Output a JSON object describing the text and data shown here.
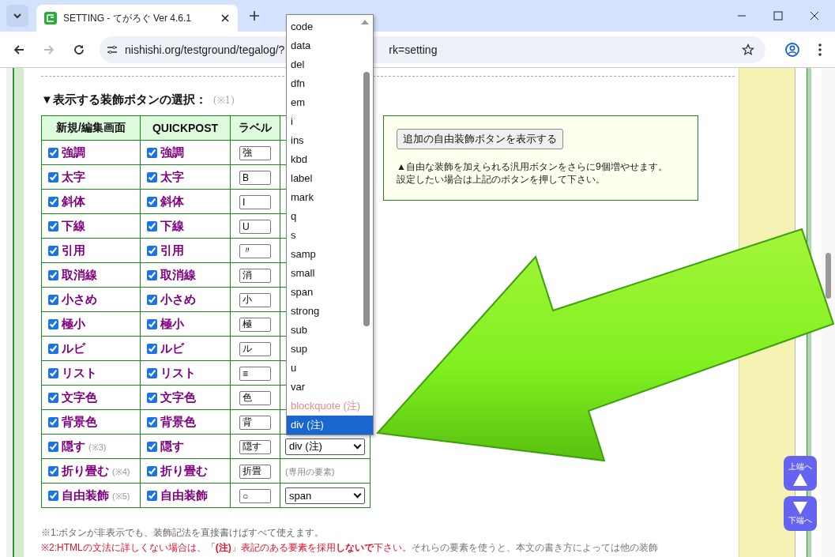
{
  "browser": {
    "tab_title": "SETTING - てがろぐ Ver 4.6.1",
    "url_parts": [
      "nishishi.org/testground/tegalog/?",
      "rk=setting"
    ],
    "forward_disabled": true
  },
  "heading": {
    "title": "▼表示する装飾ボタンの選択：",
    "note": "(※1)"
  },
  "table": {
    "columns": [
      "新規/編集画面",
      "QUICKPOST",
      "ラベル"
    ],
    "rows": [
      {
        "editor": {
          "checked": true,
          "label": "強調"
        },
        "quickpost": {
          "checked": true,
          "label": "強調"
        },
        "label_value": "強"
      },
      {
        "editor": {
          "checked": true,
          "label": "太字"
        },
        "quickpost": {
          "checked": true,
          "label": "太字"
        },
        "label_value": "B"
      },
      {
        "editor": {
          "checked": true,
          "label": "斜体"
        },
        "quickpost": {
          "checked": true,
          "label": "斜体"
        },
        "label_value": "I"
      },
      {
        "editor": {
          "checked": true,
          "label": "下線"
        },
        "quickpost": {
          "checked": true,
          "label": "下線"
        },
        "label_value": "U"
      },
      {
        "editor": {
          "checked": true,
          "label": "引用"
        },
        "quickpost": {
          "checked": true,
          "label": "引用"
        },
        "label_value": "〃"
      },
      {
        "editor": {
          "checked": true,
          "label": "取消線"
        },
        "quickpost": {
          "checked": true,
          "label": "取消線"
        },
        "label_value": "消"
      },
      {
        "editor": {
          "checked": true,
          "label": "小さめ"
        },
        "quickpost": {
          "checked": true,
          "label": "小さめ"
        },
        "label_value": "小"
      },
      {
        "editor": {
          "checked": true,
          "label": "極小"
        },
        "quickpost": {
          "checked": true,
          "label": "極小"
        },
        "label_value": "極"
      },
      {
        "editor": {
          "checked": true,
          "label": "ルビ"
        },
        "quickpost": {
          "checked": true,
          "label": "ルビ"
        },
        "label_value": "ル"
      },
      {
        "editor": {
          "checked": true,
          "label": "リスト"
        },
        "quickpost": {
          "checked": true,
          "label": "リスト"
        },
        "label_value": "≡"
      },
      {
        "editor": {
          "checked": true,
          "label": "文字色"
        },
        "quickpost": {
          "checked": true,
          "label": "文字色"
        },
        "label_value": "色"
      },
      {
        "editor": {
          "checked": true,
          "label": "背景色"
        },
        "quickpost": {
          "checked": true,
          "label": "背景色"
        },
        "label_value": "背"
      },
      {
        "editor": {
          "checked": true,
          "label": "隠す",
          "note": "(※3)"
        },
        "quickpost": {
          "checked": true,
          "label": "隠す"
        },
        "label_value": "隠す",
        "column_4": {
          "kind": "select",
          "value": "div (注)"
        }
      },
      {
        "editor": {
          "checked": true,
          "label": "折り畳む",
          "note": "(※4)"
        },
        "quickpost": {
          "checked": true,
          "label": "折り畳む"
        },
        "label_value": "折畳",
        "column_4": {
          "kind": "text",
          "value": "(専用の要素)"
        }
      },
      {
        "editor": {
          "checked": true,
          "label": "自由装飾",
          "note": "(※5)"
        },
        "quickpost": {
          "checked": true,
          "label": "自由装飾"
        },
        "label_value": "○",
        "column_4": {
          "kind": "select",
          "value": "span"
        }
      }
    ]
  },
  "dropdown": {
    "options": [
      {
        "label": "code",
        "selected": false,
        "disabled": false
      },
      {
        "label": "data",
        "selected": false,
        "disabled": false
      },
      {
        "label": "del",
        "selected": false,
        "disabled": false
      },
      {
        "label": "dfn",
        "selected": false,
        "disabled": false
      },
      {
        "label": "em",
        "selected": false,
        "disabled": false
      },
      {
        "label": "i",
        "selected": false,
        "disabled": false
      },
      {
        "label": "ins",
        "selected": false,
        "disabled": false
      },
      {
        "label": "kbd",
        "selected": false,
        "disabled": false
      },
      {
        "label": "label",
        "selected": false,
        "disabled": false
      },
      {
        "label": "mark",
        "selected": false,
        "disabled": false
      },
      {
        "label": "q",
        "selected": false,
        "disabled": false
      },
      {
        "label": "s",
        "selected": false,
        "disabled": false
      },
      {
        "label": "samp",
        "selected": false,
        "disabled": false
      },
      {
        "label": "small",
        "selected": false,
        "disabled": false
      },
      {
        "label": "span",
        "selected": false,
        "disabled": false
      },
      {
        "label": "strong",
        "selected": false,
        "disabled": false
      },
      {
        "label": "sub",
        "selected": false,
        "disabled": false
      },
      {
        "label": "sup",
        "selected": false,
        "disabled": false
      },
      {
        "label": "u",
        "selected": false,
        "disabled": false
      },
      {
        "label": "var",
        "selected": false,
        "disabled": false
      },
      {
        "label": "blockquote (注)",
        "selected": false,
        "disabled": true
      },
      {
        "label": "div (注)",
        "selected": true,
        "disabled": false
      }
    ]
  },
  "side_panel": {
    "button": "追加の自由装飾ボタンを表示する",
    "lines": [
      "▲自由な装飾を加えられる汎用ボタンをさらに9個増やせます。",
      "設定したい場合は上記のボタンを押して下さい。"
    ]
  },
  "notes": {
    "note_1": "※1:ボタンが非表示でも、装飾記法を直接書けばすべて使えます。",
    "note_2_warning": "※2:HTMLの文法に詳しくない場合は、「**(注)**」表記のある要素を採用**しないで**下さい。",
    "note_2_text": "それらの要素を使うと、本文の書き方によっては他の装飾"
  },
  "page_buttons": {
    "top": "上端へ",
    "bottom": "下端へ"
  }
}
